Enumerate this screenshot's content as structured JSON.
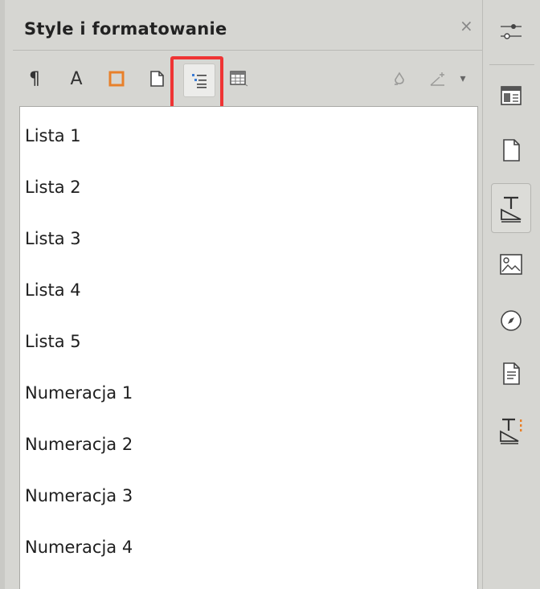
{
  "panel": {
    "title": "Style i formatowanie",
    "close_icon": "close-icon",
    "toolbar": [
      {
        "icon": "paragraph-styles-icon",
        "label": "¶"
      },
      {
        "icon": "character-styles-icon",
        "label": "A"
      },
      {
        "icon": "frame-styles-icon"
      },
      {
        "icon": "page-styles-icon"
      },
      {
        "icon": "list-styles-icon",
        "selected": true
      },
      {
        "icon": "table-styles-icon"
      },
      {
        "icon": "fill-format-mode-icon"
      },
      {
        "icon": "new-style-from-selection-icon"
      },
      {
        "icon": "dropdown-arrow-icon",
        "label": "▾"
      }
    ]
  },
  "styles_list": {
    "items": [
      "Lista 1",
      "Lista 2",
      "Lista 3",
      "Lista 4",
      "Lista 5",
      "Numeracja 1",
      "Numeracja 2",
      "Numeracja 3",
      "Numeracja 4"
    ]
  },
  "sidebar": {
    "items": [
      {
        "icon": "properties-icon"
      },
      {
        "icon": "page-icon"
      },
      {
        "icon": "styles-icon",
        "active": true
      },
      {
        "icon": "gallery-icon"
      },
      {
        "icon": "navigator-icon"
      },
      {
        "icon": "manage-changes-icon"
      },
      {
        "icon": "design-icon"
      }
    ]
  },
  "colors": {
    "highlight": "#ef3434",
    "frame_icon": "#e8802a"
  }
}
